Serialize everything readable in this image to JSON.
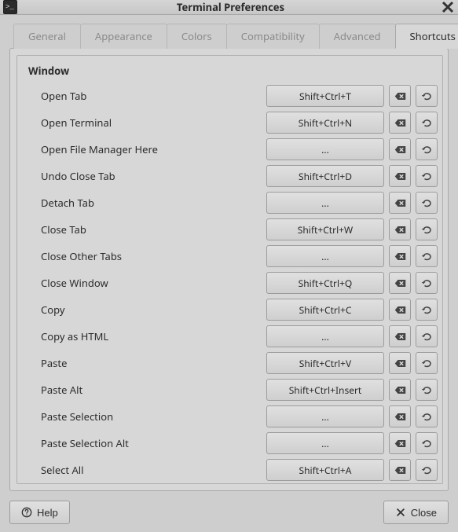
{
  "window": {
    "title": "Terminal Preferences"
  },
  "tabs": [
    {
      "label": "General"
    },
    {
      "label": "Appearance"
    },
    {
      "label": "Colors"
    },
    {
      "label": "Compatibility"
    },
    {
      "label": "Advanced"
    },
    {
      "label": "Shortcuts"
    }
  ],
  "active_tab": 5,
  "section": {
    "title": "Window"
  },
  "shortcuts": [
    {
      "label": "Open Tab",
      "keys": "Shift+Ctrl+T"
    },
    {
      "label": "Open Terminal",
      "keys": "Shift+Ctrl+N"
    },
    {
      "label": "Open File Manager Here",
      "keys": "..."
    },
    {
      "label": "Undo Close Tab",
      "keys": "Shift+Ctrl+D"
    },
    {
      "label": "Detach Tab",
      "keys": "..."
    },
    {
      "label": "Close Tab",
      "keys": "Shift+Ctrl+W"
    },
    {
      "label": "Close Other Tabs",
      "keys": "..."
    },
    {
      "label": "Close Window",
      "keys": "Shift+Ctrl+Q"
    },
    {
      "label": "Copy",
      "keys": "Shift+Ctrl+C"
    },
    {
      "label": "Copy as HTML",
      "keys": "..."
    },
    {
      "label": "Paste",
      "keys": "Shift+Ctrl+V"
    },
    {
      "label": "Paste Alt",
      "keys": "Shift+Ctrl+Insert"
    },
    {
      "label": "Paste Selection",
      "keys": "..."
    },
    {
      "label": "Paste Selection Alt",
      "keys": "..."
    },
    {
      "label": "Select All",
      "keys": "Shift+Ctrl+A"
    }
  ],
  "footer": {
    "help": "Help",
    "close": "Close"
  }
}
